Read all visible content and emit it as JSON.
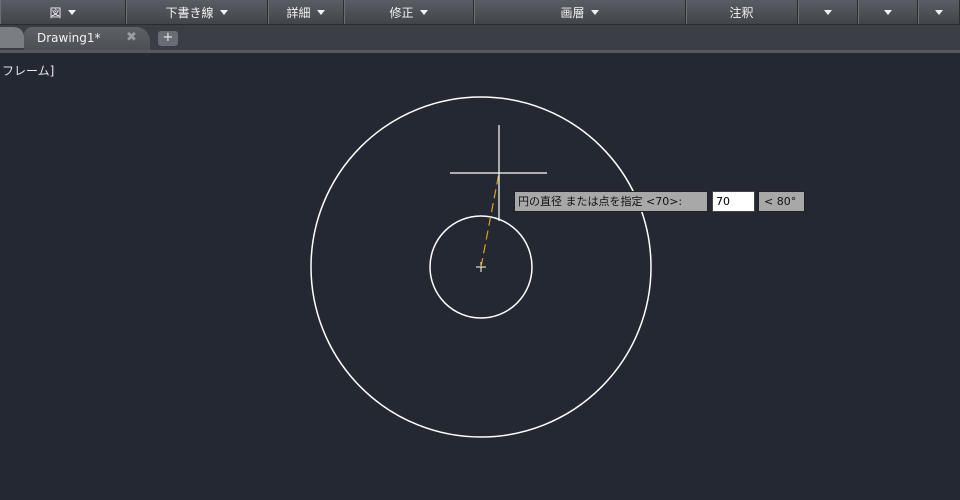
{
  "ribbon": {
    "panels": [
      {
        "label": "図",
        "has_caret": true
      },
      {
        "label": "",
        "has_caret": false
      },
      {
        "label": "下書き線",
        "has_caret": true
      },
      {
        "label": "詳細",
        "has_caret": true
      },
      {
        "label": "修正",
        "has_caret": true
      },
      {
        "label": "画層",
        "has_caret": true
      },
      {
        "label": "注釈",
        "has_caret": false
      },
      {
        "label": "",
        "has_caret": true
      },
      {
        "label": "",
        "has_caret": true
      },
      {
        "label": "",
        "has_caret": true
      }
    ]
  },
  "tabs": {
    "active_label": "Drawing1*",
    "close_glyph": "✖",
    "new_glyph": "+"
  },
  "viewport": {
    "label": "ﾞフレーム]"
  },
  "command": {
    "prompt": "円の直径 または点を指定 <70>:",
    "input_value": "70",
    "angle": "< 80°"
  },
  "colors": {
    "canvas": "#232833",
    "geometry": "#ffffff",
    "rubber_band": "#e0a020"
  }
}
